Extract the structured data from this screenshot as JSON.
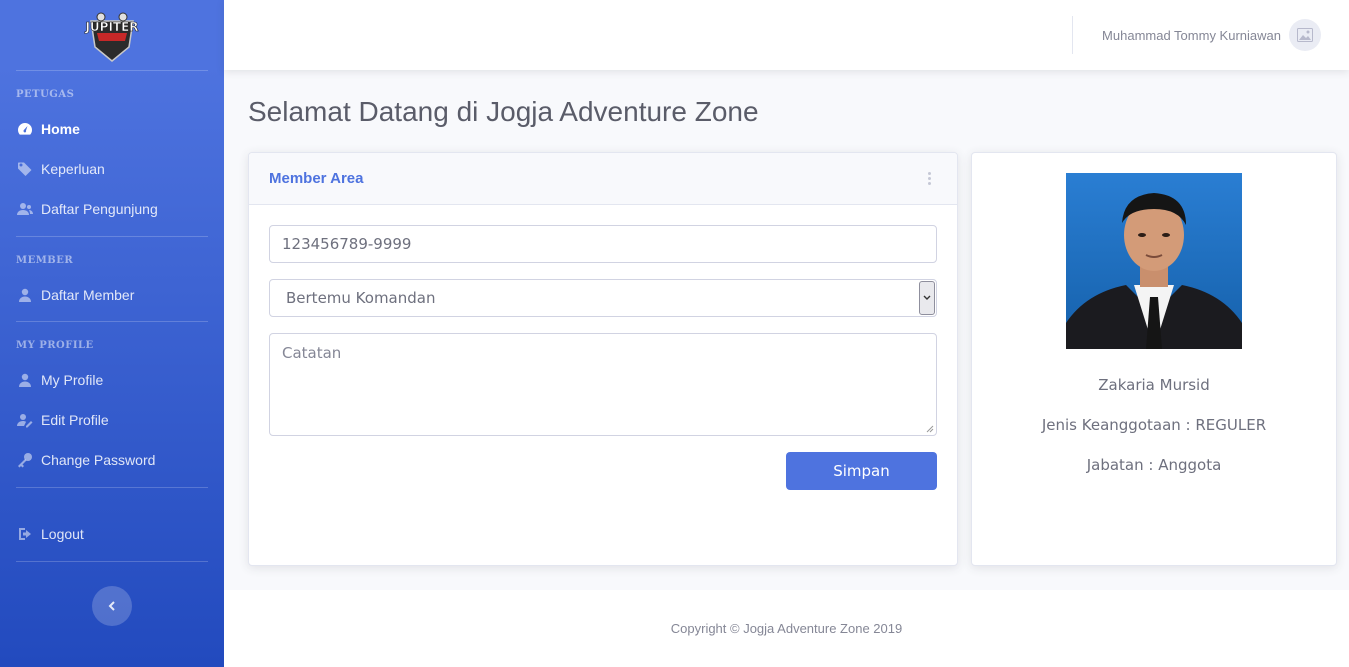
{
  "brand": {
    "logo_text": "JUPITER"
  },
  "sidebar": {
    "sections": [
      {
        "heading": "PETUGAS"
      },
      {
        "heading": "MEMBER"
      },
      {
        "heading": "MY PROFILE"
      }
    ],
    "items": [
      {
        "label": "Home",
        "icon": "tachometer-icon"
      },
      {
        "label": "Keperluan",
        "icon": "tag-icon"
      },
      {
        "label": "Daftar Pengunjung",
        "icon": "users-icon"
      },
      {
        "label": "Daftar Member",
        "icon": "user-icon"
      },
      {
        "label": "My Profile",
        "icon": "user-icon"
      },
      {
        "label": "Edit Profile",
        "icon": "user-edit-icon"
      },
      {
        "label": "Change Password",
        "icon": "key-icon"
      },
      {
        "label": "Logout",
        "icon": "sign-out-icon"
      }
    ]
  },
  "topbar": {
    "user_name": "Muhammad Tommy Kurniawan"
  },
  "page": {
    "title": "Selamat Datang di Jogja Adventure Zone"
  },
  "member_card": {
    "title": "Member Area",
    "id_value": "123456789-9999",
    "keperluan_selected": "Bertemu Komandan",
    "catatan_placeholder": "Catatan",
    "submit_label": "Simpan"
  },
  "profile_card": {
    "name": "Zakaria Mursid",
    "membership": "Jenis Keanggotaan : REGULER",
    "position": "Jabatan : Anggota"
  },
  "footer": {
    "copyright": "Copyright © Jogja Adventure Zone 2019"
  },
  "colors": {
    "primary": "#4e73df",
    "sidebar_end": "#224abe",
    "text_muted": "#858796"
  }
}
